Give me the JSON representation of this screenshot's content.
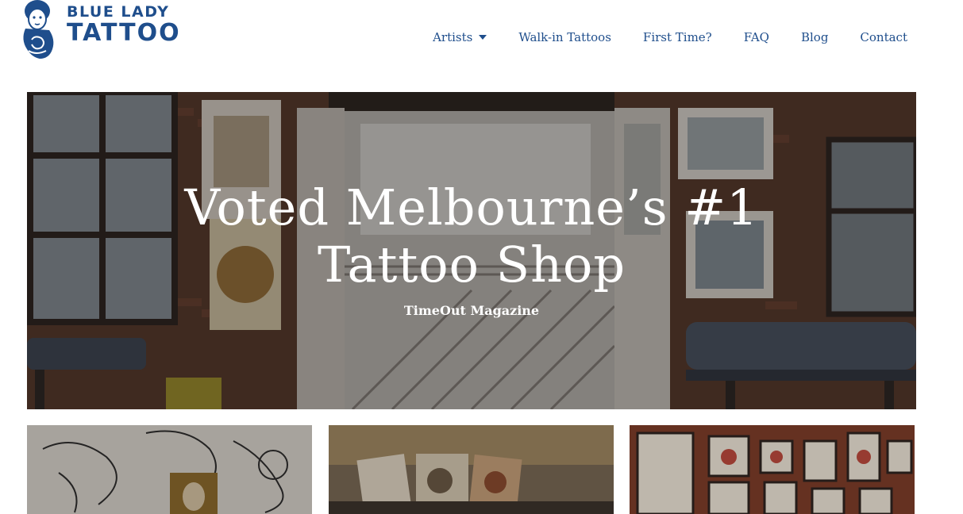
{
  "brand": {
    "line1": "BLUE LADY",
    "line2": "TATTOO",
    "logo_icon": "blue-lady-portrait-icon",
    "color": "#1f4e8c"
  },
  "nav": {
    "items": [
      {
        "label": "Artists",
        "has_dropdown": true
      },
      {
        "label": "Walk-in Tattoos"
      },
      {
        "label": "First Time?"
      },
      {
        "label": "FAQ"
      },
      {
        "label": "Blog"
      },
      {
        "label": "Contact"
      }
    ]
  },
  "hero": {
    "title_line1": "Voted Melbourne’s #1",
    "title_line2": "Tattoo Shop",
    "subtitle": "TimeOut Magazine"
  },
  "cards": [
    {
      "name": "flash-drawings-card"
    },
    {
      "name": "tattoo-cards-card"
    },
    {
      "name": "framed-art-wall-card"
    }
  ]
}
